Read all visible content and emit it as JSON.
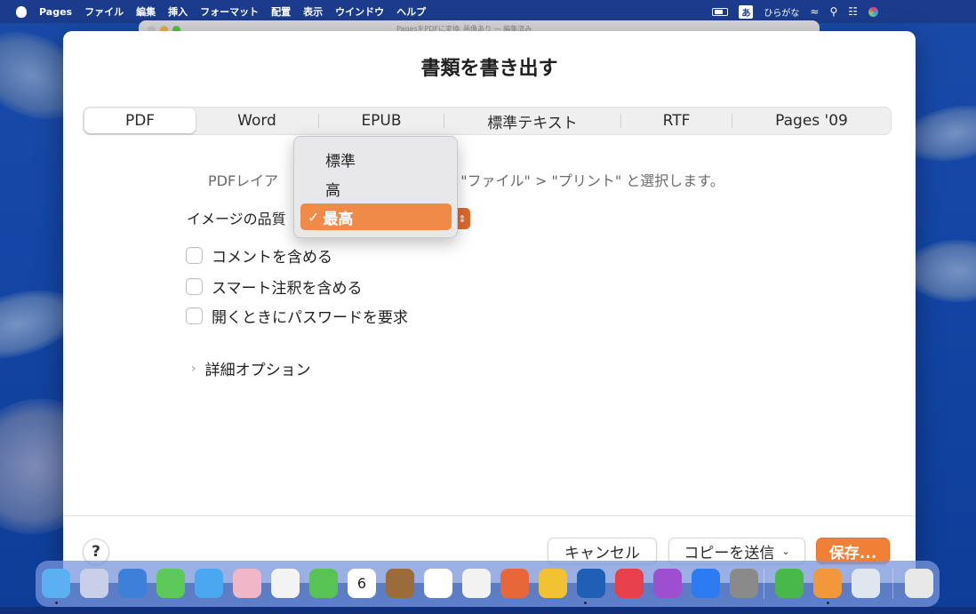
{
  "menubar": {
    "app_name": "Pages",
    "items": [
      "ファイル",
      "編集",
      "挿入",
      "フォーマット",
      "配置",
      "表示",
      "ウインドウ",
      "ヘルプ"
    ],
    "input_mode_badge": "あ",
    "input_mode_label": "ひらがな",
    "status_icons": [
      "battery-charging-icon",
      "wifi-icon",
      "spotlight-search-icon",
      "control-center-icon",
      "siri-icon"
    ]
  },
  "background_window": {
    "title": "PagesをPDFに変換_画像あり — 編集済み"
  },
  "dialog": {
    "title": "書類を書き出す",
    "tabs": [
      {
        "label": "PDF",
        "selected": true
      },
      {
        "label": "Word",
        "selected": false
      },
      {
        "label": "EPUB",
        "selected": false
      },
      {
        "label": "標準テキスト",
        "selected": false
      },
      {
        "label": "RTF",
        "selected": false
      },
      {
        "label": "Pages '09",
        "selected": false
      }
    ],
    "info_text": "PDFレイアウトを変更するには、\"ファイル\" > \"プリント\" と選択します。",
    "info_text_visible_left": "PDFレイア",
    "info_text_visible_right": "は、\"ファイル\" > \"プリント\" と選択します。",
    "image_quality": {
      "label": "イメージの品質:",
      "label_visible": "イメージの品質",
      "selected": "最高",
      "options": [
        {
          "label": "標準",
          "selected": false
        },
        {
          "label": "高",
          "selected": false
        },
        {
          "label": "最高",
          "selected": true
        }
      ]
    },
    "checkboxes": [
      {
        "label": "コメントを含める",
        "checked": false
      },
      {
        "label": "スマート注釈を含める",
        "checked": false
      },
      {
        "label": "開くときにパスワードを要求",
        "checked": false
      }
    ],
    "advanced_options_label": "詳細オプション",
    "help_label": "?",
    "buttons": {
      "cancel": "キャンセル",
      "send_copy": "コピーを送信",
      "save": "保存..."
    }
  },
  "colors": {
    "accent": "#f08035",
    "menubar": "#1b3c8c",
    "desktop": "#1346a6"
  },
  "dock": {
    "apps": [
      "Finder",
      "Launchpad",
      "Safari",
      "メッセージ",
      "メール",
      "マップ",
      "写真",
      "FaceTime",
      "カレンダー",
      "メモ帳",
      "リマインダー",
      "メモ",
      "Firefox",
      "Chrome",
      "Word",
      "ミュージック",
      "Podcast",
      "App Store",
      "システム環境設定",
      "Numbers",
      "Pages",
      "プレビュー",
      "ゴミ箱"
    ],
    "calendar_day": "6"
  }
}
